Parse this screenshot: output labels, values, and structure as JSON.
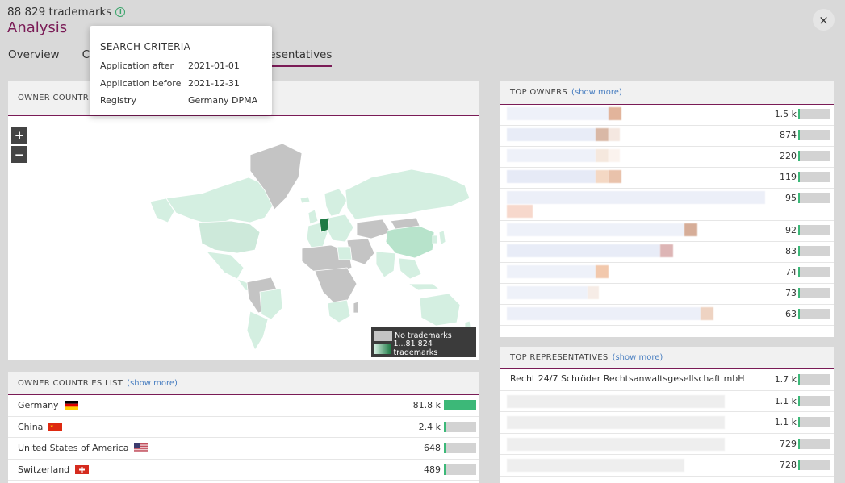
{
  "header": {
    "count": "88 829 trademarks",
    "title": "Analysis",
    "tabs": [
      {
        "label": "Overview"
      },
      {
        "label": "Cla"
      },
      {
        "label": "resentatives"
      }
    ],
    "close": "×"
  },
  "tooltip": {
    "title": "SEARCH CRITERIA",
    "rows": [
      {
        "key": "Application after",
        "value": "2021-01-01"
      },
      {
        "key": "Application before",
        "value": "2021-12-31"
      },
      {
        "key": "Registry",
        "value": "Germany DPMA"
      }
    ]
  },
  "map_panel": {
    "title": "OWNER COUNTRI",
    "zoom_in": "+",
    "zoom_out": "−",
    "legend": {
      "no": "No trademarks",
      "yes": "1...81 824 trademarks"
    }
  },
  "countries_panel": {
    "title": "OWNER COUNTRIES LIST",
    "show_more": "(show more)",
    "rows": [
      {
        "name": "Germany",
        "value": "81.8 k",
        "share": 1.0,
        "flag": "de"
      },
      {
        "name": "China",
        "value": "2.4 k",
        "share": 0.03,
        "flag": "cn"
      },
      {
        "name": "United States of America",
        "value": "648",
        "share": 0.01,
        "flag": "us"
      },
      {
        "name": "Switzerland",
        "value": "489",
        "share": 0.01,
        "flag": "ch"
      }
    ]
  },
  "owners_panel": {
    "title": "TOP OWNERS",
    "show_more": "(show more)",
    "values": [
      "1.5 k",
      "874",
      "220",
      "119",
      "95",
      "92",
      "83",
      "74",
      "73",
      "63"
    ]
  },
  "reps_panel": {
    "title": "TOP REPRESENTATIVES",
    "show_more": "(show more)",
    "first_name": "Recht 24/7 Schröder Rechtsanwaltsgesellschaft mbH",
    "values": [
      "1.7 k",
      "1.1 k",
      "1.1 k",
      "729",
      "728"
    ]
  },
  "colors": {
    "accent": "#7a1b56",
    "green": "#3cb878",
    "map_none": "#c4c4c4",
    "map_low": "#d4efe1",
    "map_high": "#1e7a45"
  }
}
